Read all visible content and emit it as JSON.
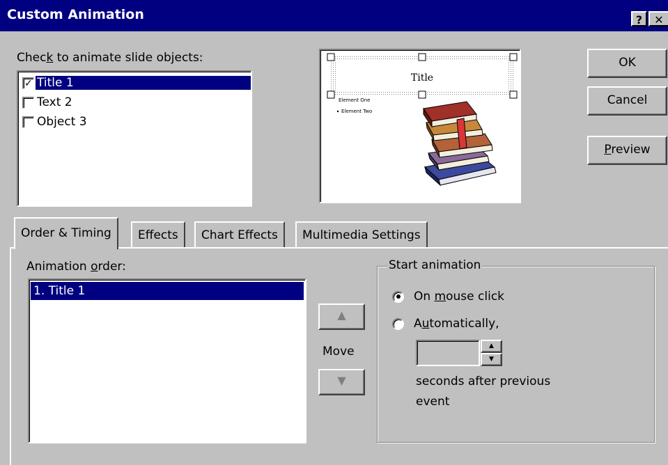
{
  "window": {
    "title": "Custom Animation",
    "help_glyph": "?",
    "close_glyph": "✕"
  },
  "objects": {
    "label_pre": "Chec",
    "label_key": "k",
    "label_post": " to animate slide objects:",
    "items": [
      {
        "label": "Title 1",
        "checked": true
      },
      {
        "label": "Text 2",
        "checked": false
      },
      {
        "label": "Object 3",
        "checked": false
      }
    ]
  },
  "preview_slide": {
    "title": "Title",
    "bullets": [
      "Element One",
      "Element Two"
    ],
    "image_icon": "books-icon"
  },
  "buttons": {
    "ok": "OK",
    "cancel": "Cancel",
    "preview_key": "P",
    "preview_rest": "review"
  },
  "tabs": [
    {
      "label": "Order & Timing",
      "active": true
    },
    {
      "label": "Effects",
      "active": false
    },
    {
      "label": "Chart Effects",
      "active": false
    },
    {
      "label": "Multimedia Settings",
      "active": false
    }
  ],
  "order": {
    "label_pre": "Animation ",
    "label_key": "o",
    "label_post": "rder:",
    "items": [
      "1. Title 1"
    ],
    "move_label": "Move",
    "up_icon": "arrow-up-icon",
    "down_icon": "arrow-down-icon"
  },
  "start": {
    "group_label": "Start animation",
    "mouse_pre": "On ",
    "mouse_key": "m",
    "mouse_post": "ouse click",
    "auto_pre": "A",
    "auto_key": "u",
    "auto_post": "tomatically,",
    "seconds_value": "",
    "seconds_line1": "seconds after previous",
    "seconds_line2": "event",
    "selected": "On mouse click"
  }
}
